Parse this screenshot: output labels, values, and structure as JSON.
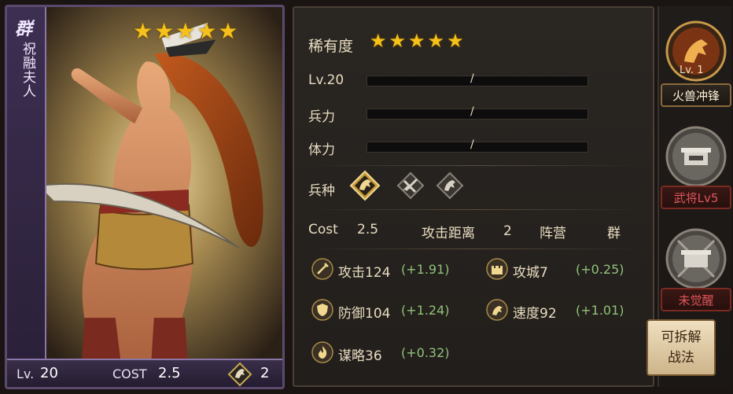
{
  "card": {
    "faction": "群",
    "name": "祝融夫人",
    "stars": "★★★★★",
    "lv_label": "Lv.",
    "lv_value": "20",
    "cost_label": "COST",
    "cost_value": "2.5",
    "troop_count": "2"
  },
  "panel": {
    "rarity_label": "稀有度",
    "rarity_stars": "★★★★★",
    "level_label": "Lv.20",
    "level_bar": "/",
    "troops_label": "兵力",
    "troops_bar": "/",
    "stamina_label": "体力",
    "stamina_bar": "/",
    "unit_type_label": "兵种",
    "cost_label": "Cost",
    "cost_value": "2.5",
    "range_label": "攻击距离",
    "range_value": "2",
    "camp_label": "阵营",
    "camp_value": "群",
    "stats": {
      "attack": {
        "text": "攻击124",
        "bonus": "(+1.91)"
      },
      "siege": {
        "text": "攻城7",
        "bonus": "(+0.25)"
      },
      "defense": {
        "text": "防御104",
        "bonus": "(+1.24)"
      },
      "speed": {
        "text": "速度92",
        "bonus": "(+1.01)"
      },
      "strategy": {
        "text": "谋略36",
        "bonus": "(+0.32)"
      }
    }
  },
  "skills": {
    "skill_1": {
      "lv": "Lv. 1",
      "label": "火兽冲锋"
    },
    "skill_2": {
      "label": "武将Lv5"
    },
    "skill_3": {
      "label": "未觉醒"
    },
    "dismantle": {
      "line1": "可拆解",
      "line2": "战法"
    }
  },
  "colors": {
    "star": "#f5c11a",
    "bonus_green": "#8fc27a",
    "locked_red": "#e0565a",
    "faction_purple": "#5b4a6e"
  }
}
